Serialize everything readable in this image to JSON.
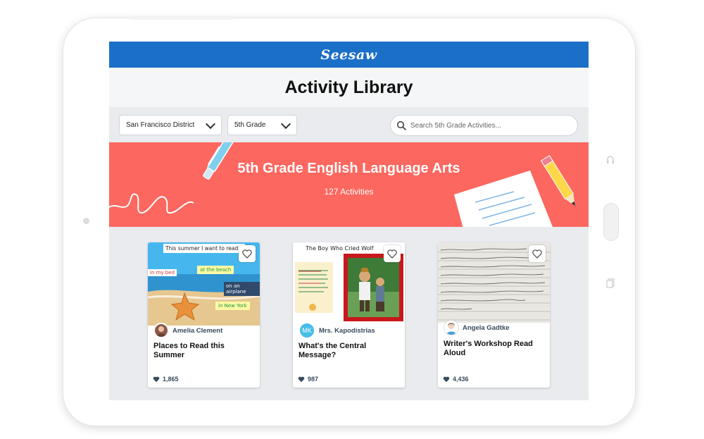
{
  "app": {
    "logo": "Seesaw"
  },
  "page": {
    "title": "Activity Library"
  },
  "filters": {
    "district": "San Francisco District",
    "grade": "5th Grade",
    "search_placeholder": "Search 5th Grade Activities..."
  },
  "banner": {
    "title": "5th Grade English Language Arts",
    "count": "127 Activities",
    "color": "#fc675f"
  },
  "colors": {
    "brand": "#1a6fc7",
    "banner": "#fc675f"
  },
  "cards": [
    {
      "author": "Amelia Clement",
      "title": "Places to Read this Summer",
      "likes": "1,865",
      "thumb_labels": [
        "This summer I want to read...",
        "in my bed",
        "at the beach",
        "on an airplane",
        "in New York"
      ]
    },
    {
      "author": "Mrs. Kapodistrias",
      "author_initials": "MK",
      "title": "What's the Central Message?",
      "likes": "987",
      "thumb_labels": [
        "The Boy Who Cried Wolf"
      ]
    },
    {
      "author": "Angela Gadtke",
      "title": "Writer's Workshop Read Aloud",
      "likes": "4,436"
    }
  ]
}
